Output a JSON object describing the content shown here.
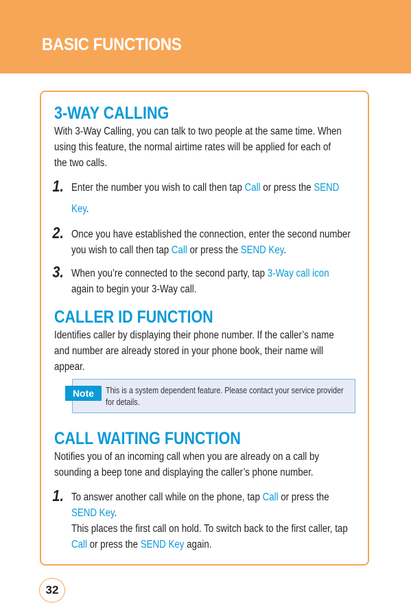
{
  "header": {
    "title": "BASIC FUNCTIONS"
  },
  "sections": {
    "three_way": {
      "title": "3-WAY CALLING",
      "intro_lines": [
        "With 3-Way Calling, you can talk to two people at the same time. When",
        "using this feature, the normal airtime rates will be applied for each of",
        "the two calls."
      ],
      "steps": [
        {
          "num": "1.",
          "line1": {
            "a": "Enter the number you wish to call then tap ",
            "b": "Call",
            "c": " or press the ",
            "d": "SEND"
          },
          "line2": {
            "a": "Key",
            "b": "."
          }
        },
        {
          "num": "2.",
          "line1": "Once you have established the connection, enter the second number",
          "line2": {
            "a": "you wish to call then tap ",
            "b": "Call",
            "c": " or press the ",
            "d": "SEND Key",
            "e": "."
          }
        },
        {
          "num": "3.",
          "line1": {
            "a": "When you’re connected to the second party, tap ",
            "b": "3-Way call icon"
          },
          "line2": "again to begin your 3-Way call."
        }
      ]
    },
    "caller_id": {
      "title": "CALLER ID FUNCTION",
      "intro_lines": [
        "Identifies caller by displaying their phone number. If the caller’s name",
        "and number are already stored in your phone book, their name will",
        "appear."
      ],
      "note": {
        "label": "Note",
        "line1": "This is a system dependent feature. Please contact your service provider",
        "line2": "for details."
      }
    },
    "call_waiting": {
      "title": "CALL WAITING FUNCTION",
      "intro_lines": [
        "Notifies you of an incoming call when you are already on a call by",
        "sounding a beep tone and displaying the caller’s phone number."
      ],
      "steps": [
        {
          "num": "1.",
          "line1": {
            "a": "To answer another call while on the phone, tap ",
            "b": "Call",
            "c": " or press the"
          },
          "line2": {
            "a": "SEND Key",
            "b": "."
          },
          "line3": "This places the first call on hold. To switch back to the first caller, tap",
          "line4": {
            "a": "Call",
            "b": " or press the ",
            "c": "SEND Key",
            "d": " again."
          }
        }
      ]
    }
  },
  "footer": {
    "page_number": "32"
  },
  "colors": {
    "accent_orange": "#f7a657",
    "accent_blue": "#0a9ad6",
    "note_bg": "#e6ebf7"
  }
}
